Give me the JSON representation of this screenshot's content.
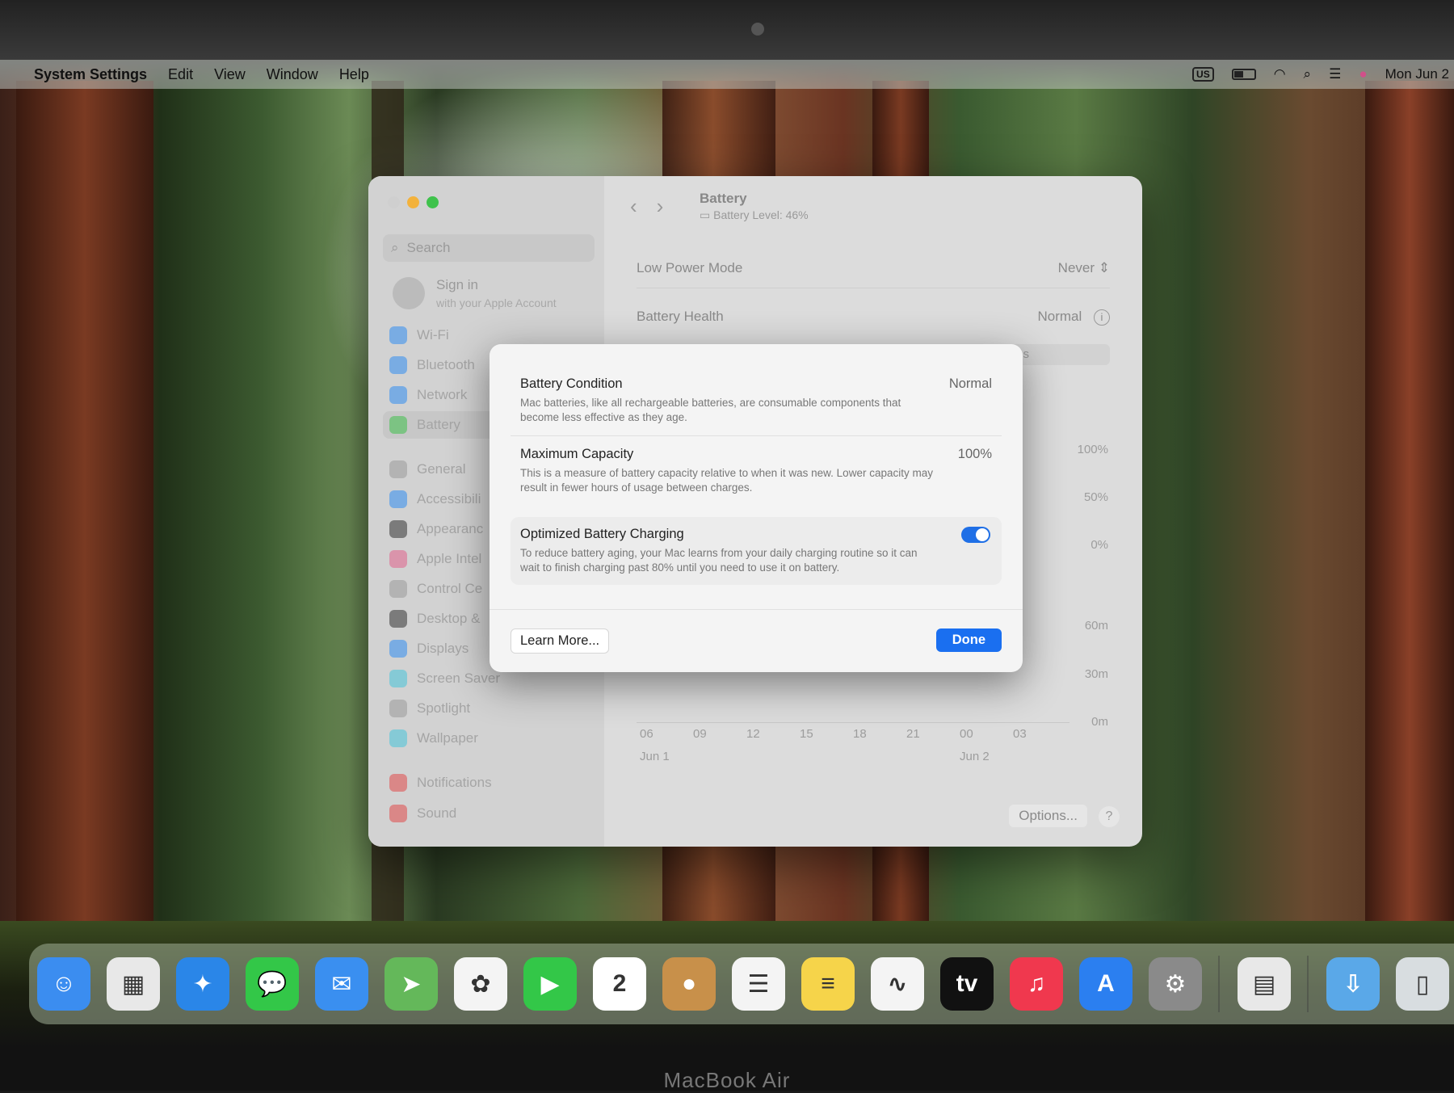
{
  "menubar": {
    "app_name": "System Settings",
    "items": [
      "Edit",
      "View",
      "Window",
      "Help"
    ],
    "input_source": "US",
    "clock": "Mon Jun 2"
  },
  "window": {
    "search_placeholder": "Search",
    "signin": {
      "title": "Sign in",
      "subtitle": "with your Apple Account"
    },
    "sidebar": [
      {
        "label": "Wi-Fi",
        "color": "#2f8cf0"
      },
      {
        "label": "Bluetooth",
        "color": "#2f8cf0"
      },
      {
        "label": "Network",
        "color": "#2f8cf0"
      },
      {
        "label": "Battery",
        "color": "#3ec04a",
        "selected": true
      },
      {
        "label": "General",
        "color": "#999999"
      },
      {
        "label": "Accessibili",
        "color": "#2f8cf0"
      },
      {
        "label": "Appearanc",
        "color": "#333333"
      },
      {
        "label": "Apple Intel",
        "color": "#e0608a"
      },
      {
        "label": "Control Ce",
        "color": "#999999"
      },
      {
        "label": "Desktop &",
        "color": "#333333"
      },
      {
        "label": "Displays",
        "color": "#2f8cf0"
      },
      {
        "label": "Screen Saver",
        "color": "#46c3d8"
      },
      {
        "label": "Spotlight",
        "color": "#999999"
      },
      {
        "label": "Wallpaper",
        "color": "#46c3d8"
      },
      {
        "label": "Notifications",
        "color": "#e04848"
      },
      {
        "label": "Sound",
        "color": "#e04848"
      }
    ],
    "header": {
      "title": "Battery",
      "subtitle": "Battery Level: 46%"
    },
    "rows": {
      "low_power": {
        "label": "Low Power Mode",
        "value": "Never"
      },
      "health": {
        "label": "Battery Health",
        "value": "Normal"
      },
      "partial_tab": "s"
    },
    "chart": {
      "y_level": [
        "100%",
        "50%",
        "0%"
      ],
      "y_usage": [
        "60m",
        "30m",
        "0m"
      ],
      "x_ticks": [
        "06",
        "09",
        "12",
        "15",
        "18",
        "21",
        "00",
        "03"
      ],
      "x_dates": [
        "Jun 1",
        "Jun 2"
      ],
      "partial_tick": "3"
    },
    "options_label": "Options...",
    "help_label": "?"
  },
  "dialog": {
    "condition": {
      "title": "Battery Condition",
      "value": "Normal",
      "desc": "Mac batteries, like all rechargeable batteries, are consumable components that become less effective as they age."
    },
    "capacity": {
      "title": "Maximum Capacity",
      "value": "100%",
      "desc": "This is a measure of battery capacity relative to when it was new. Lower capacity may result in fewer hours of usage between charges."
    },
    "optimized": {
      "title": "Optimized Battery Charging",
      "enabled": true,
      "desc": "To reduce battery aging, your Mac learns from your daily charging routine so it can wait to finish charging past 80% until you need to use it on battery."
    },
    "learn_more": "Learn More...",
    "done": "Done"
  },
  "dock": {
    "apps": [
      {
        "name": "Finder",
        "glyph": "☺",
        "color": "#3b8df0"
      },
      {
        "name": "Launchpad",
        "glyph": "▦",
        "color": "#e8e8e8"
      },
      {
        "name": "Safari",
        "glyph": "✦",
        "color": "#2a86e8"
      },
      {
        "name": "Messages",
        "glyph": "💬",
        "color": "#33c748"
      },
      {
        "name": "Mail",
        "glyph": "✉",
        "color": "#3a8ff0"
      },
      {
        "name": "Maps",
        "glyph": "➤",
        "color": "#64b85a"
      },
      {
        "name": "Photos",
        "glyph": "✿",
        "color": "#f4f4f4"
      },
      {
        "name": "FaceTime",
        "glyph": "▶",
        "color": "#33c748"
      },
      {
        "name": "Calendar",
        "glyph": "2",
        "color": "#ffffff",
        "badge": "JUN"
      },
      {
        "name": "Contacts",
        "glyph": "●",
        "color": "#c8904a"
      },
      {
        "name": "Reminders",
        "glyph": "☰",
        "color": "#f4f4f4"
      },
      {
        "name": "Notes",
        "glyph": "≡",
        "color": "#f6d44a"
      },
      {
        "name": "Freeform",
        "glyph": "∿",
        "color": "#f4f4f4"
      },
      {
        "name": "TV",
        "glyph": "tv",
        "color": "#111111"
      },
      {
        "name": "Music",
        "glyph": "♫",
        "color": "#f0384e"
      },
      {
        "name": "App Store",
        "glyph": "A",
        "color": "#2b7ff0"
      },
      {
        "name": "System Settings",
        "glyph": "⚙",
        "color": "#8a8a8a"
      },
      {
        "name": "Archive Utility",
        "glyph": "▤",
        "color": "#e8e8e8"
      },
      {
        "name": "Downloads",
        "glyph": "⇩",
        "color": "#5aa8e8"
      },
      {
        "name": "Trash",
        "glyph": "▯",
        "color": "#d8dde0"
      }
    ]
  },
  "device_label": "MacBook Air"
}
